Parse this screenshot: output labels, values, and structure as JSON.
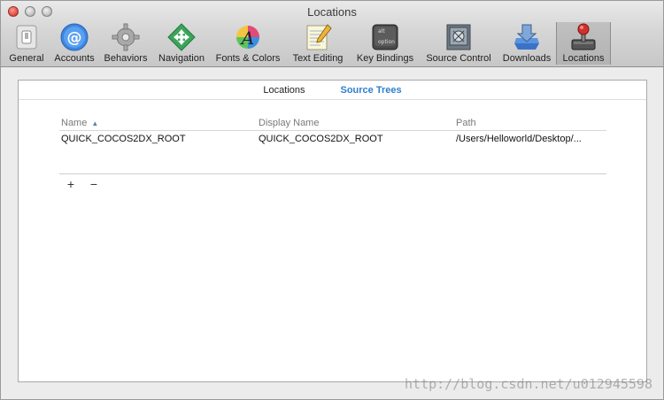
{
  "window": {
    "title": "Locations"
  },
  "toolbar": {
    "items": [
      {
        "label": "General",
        "icon": "light-switch-icon"
      },
      {
        "label": "Accounts",
        "icon": "at-sign-icon"
      },
      {
        "label": "Behaviors",
        "icon": "gear-icon"
      },
      {
        "label": "Navigation",
        "icon": "arrows-diamond-icon"
      },
      {
        "label": "Fonts & Colors",
        "icon": "font-color-icon"
      },
      {
        "label": "Text Editing",
        "icon": "notepad-pencil-icon"
      },
      {
        "label": "Key Bindings",
        "icon": "option-key-icon"
      },
      {
        "label": "Source Control",
        "icon": "vault-icon"
      },
      {
        "label": "Downloads",
        "icon": "download-arrow-icon"
      },
      {
        "label": "Locations",
        "icon": "joystick-icon",
        "selected": true
      }
    ]
  },
  "tabs": [
    {
      "label": "Locations",
      "active": false
    },
    {
      "label": "Source Trees",
      "active": true
    }
  ],
  "table": {
    "columns": [
      "Name",
      "Display Name",
      "Path"
    ],
    "rows": [
      {
        "name": "QUICK_COCOS2DX_ROOT",
        "display": "QUICK_COCOS2DX_ROOT",
        "path": "/Users/Helloworld/Desktop/..."
      }
    ]
  },
  "buttons": {
    "add": "+",
    "remove": "−"
  },
  "watermark": "http://blog.csdn.net/u012945598",
  "colors": {
    "accent": "#2f7fd1"
  }
}
